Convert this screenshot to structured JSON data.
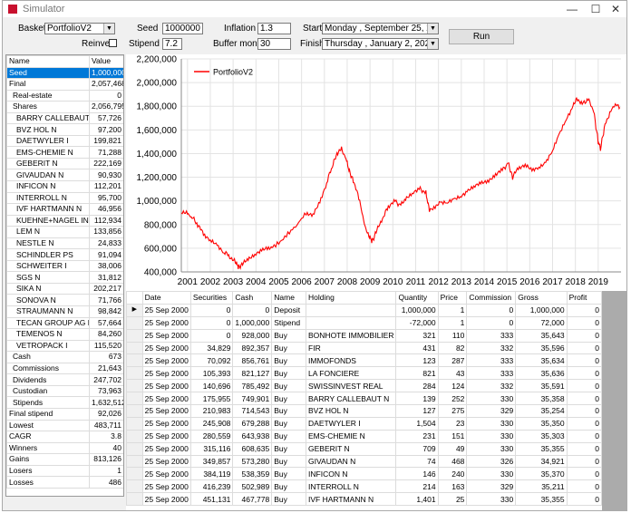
{
  "window": {
    "title": "Simulator"
  },
  "controls": {
    "basket_label": "Basket",
    "basket_value": "PortfolioV2",
    "reinvest_label": "Reinvest",
    "seed_label": "Seed",
    "seed_value": "1000000",
    "stipend_label": "Stipend %",
    "stipend_value": "7.2",
    "inflation_label": "Inflation %",
    "inflation_value": "1.3",
    "buffer_label": "Buffer months",
    "buffer_value": "30",
    "start_label": "Start",
    "start_value": "Monday   , September 25, 2000",
    "finish_label": "Finish",
    "finish_value": "Thursday   ,   January    2, 2020",
    "run_label": "Run"
  },
  "left_table": {
    "headers": [
      "Name",
      "Value"
    ],
    "rows": [
      {
        "name": "Seed",
        "value": "1,000,000"
      },
      {
        "name": "Final",
        "value": "2,057,468"
      },
      {
        "name": "Real-estate",
        "value": "0"
      },
      {
        "name": "Shares",
        "value": "2,056,795"
      },
      {
        "name": "BARRY CALLEBAUT N",
        "value": "57,726"
      },
      {
        "name": "BVZ HOL N",
        "value": "97,200"
      },
      {
        "name": "DAETWYLER I",
        "value": "199,821"
      },
      {
        "name": "EMS-CHEMIE N",
        "value": "71,288"
      },
      {
        "name": "GEBERIT N",
        "value": "222,169"
      },
      {
        "name": "GIVAUDAN N",
        "value": "90,930"
      },
      {
        "name": "INFICON N",
        "value": "112,201"
      },
      {
        "name": "INTERROLL N",
        "value": "95,700"
      },
      {
        "name": "IVF HARTMANN N",
        "value": "46,956"
      },
      {
        "name": "KUEHNE+NAGEL INT N",
        "value": "112,934"
      },
      {
        "name": "LEM N",
        "value": "133,856"
      },
      {
        "name": "NESTLE N",
        "value": "24,833"
      },
      {
        "name": "SCHINDLER PS",
        "value": "91,094"
      },
      {
        "name": "SCHWEITER I",
        "value": "38,006"
      },
      {
        "name": "SGS N",
        "value": "31,812"
      },
      {
        "name": "SIKA N",
        "value": "202,217"
      },
      {
        "name": "SONOVA N",
        "value": "71,766"
      },
      {
        "name": "STRAUMANN N",
        "value": "98,842"
      },
      {
        "name": "TECAN GROUP AG N",
        "value": "57,664"
      },
      {
        "name": "TEMENOS N",
        "value": "84,260"
      },
      {
        "name": "VETROPACK I",
        "value": "115,520"
      },
      {
        "name": "Cash",
        "value": "673"
      },
      {
        "name": "Commissions",
        "value": "21,643"
      },
      {
        "name": "Dividends",
        "value": "247,702"
      },
      {
        "name": "Custodian",
        "value": "73,963"
      },
      {
        "name": "Stipends",
        "value": "1,632,512"
      },
      {
        "name": "Final stipend",
        "value": "92,026"
      },
      {
        "name": "Lowest",
        "value": "483,711"
      },
      {
        "name": "CAGR",
        "value": "3.8"
      },
      {
        "name": "Winners",
        "value": "40"
      },
      {
        "name": "Gains",
        "value": "813,126"
      },
      {
        "name": "Losers",
        "value": "1"
      },
      {
        "name": "Losses",
        "value": "486"
      }
    ]
  },
  "chart_data": {
    "type": "line",
    "title": "",
    "xlabel": "",
    "ylabel": "",
    "x_ticks": [
      "2001",
      "2002",
      "2003",
      "2004",
      "2005",
      "2006",
      "2007",
      "2008",
      "2009",
      "2010",
      "2011",
      "2012",
      "2013",
      "2014",
      "2015",
      "2016",
      "2017",
      "2018",
      "2019"
    ],
    "y_ticks": [
      "400,000",
      "600,000",
      "800,000",
      "1,000,000",
      "1,200,000",
      "1,400,000",
      "1,600,000",
      "1,800,000",
      "2,000,000",
      "2,200,000"
    ],
    "ylim": [
      400000,
      2200000
    ],
    "xlim": [
      2000.73,
      2020.0
    ],
    "grid": true,
    "legend": "top-left",
    "series": [
      {
        "name": "PortfolioV2",
        "color": "#ff0000",
        "points": [
          [
            2000.73,
            910000
          ],
          [
            2001.0,
            890000
          ],
          [
            2001.2,
            860000
          ],
          [
            2001.45,
            800000
          ],
          [
            2001.7,
            720000
          ],
          [
            2002.0,
            660000
          ],
          [
            2002.3,
            620000
          ],
          [
            2002.6,
            570000
          ],
          [
            2002.85,
            530000
          ],
          [
            2003.1,
            480000
          ],
          [
            2003.25,
            440000
          ],
          [
            2003.45,
            470000
          ],
          [
            2003.7,
            520000
          ],
          [
            2004.0,
            560000
          ],
          [
            2004.3,
            580000
          ],
          [
            2004.6,
            600000
          ],
          [
            2005.0,
            640000
          ],
          [
            2005.4,
            720000
          ],
          [
            2005.8,
            800000
          ],
          [
            2006.2,
            900000
          ],
          [
            2006.5,
            880000
          ],
          [
            2006.8,
            980000
          ],
          [
            2007.1,
            1150000
          ],
          [
            2007.35,
            1300000
          ],
          [
            2007.55,
            1400000
          ],
          [
            2007.75,
            1440000
          ],
          [
            2007.95,
            1350000
          ],
          [
            2008.1,
            1250000
          ],
          [
            2008.3,
            1150000
          ],
          [
            2008.55,
            1000000
          ],
          [
            2008.75,
            800000
          ],
          [
            2008.95,
            700000
          ],
          [
            2009.1,
            660000
          ],
          [
            2009.3,
            750000
          ],
          [
            2009.55,
            850000
          ],
          [
            2009.8,
            950000
          ],
          [
            2010.1,
            1000000
          ],
          [
            2010.35,
            960000
          ],
          [
            2010.6,
            1030000
          ],
          [
            2010.9,
            1080000
          ],
          [
            2011.2,
            1100000
          ],
          [
            2011.45,
            1070000
          ],
          [
            2011.6,
            920000
          ],
          [
            2011.9,
            960000
          ],
          [
            2012.1,
            990000
          ],
          [
            2012.4,
            980000
          ],
          [
            2012.7,
            1010000
          ],
          [
            2013.0,
            1050000
          ],
          [
            2013.3,
            1090000
          ],
          [
            2013.6,
            1120000
          ],
          [
            2013.9,
            1150000
          ],
          [
            2014.2,
            1180000
          ],
          [
            2014.5,
            1220000
          ],
          [
            2014.8,
            1260000
          ],
          [
            2015.05,
            1320000
          ],
          [
            2015.25,
            1200000
          ],
          [
            2015.5,
            1280000
          ],
          [
            2015.8,
            1300000
          ],
          [
            2016.1,
            1250000
          ],
          [
            2016.4,
            1290000
          ],
          [
            2016.7,
            1330000
          ],
          [
            2017.0,
            1420000
          ],
          [
            2017.3,
            1560000
          ],
          [
            2017.6,
            1700000
          ],
          [
            2017.9,
            1800000
          ],
          [
            2018.05,
            1870000
          ],
          [
            2018.3,
            1820000
          ],
          [
            2018.55,
            1860000
          ],
          [
            2018.8,
            1760000
          ],
          [
            2019.0,
            1500000
          ],
          [
            2019.1,
            1440000
          ],
          [
            2019.3,
            1650000
          ],
          [
            2019.55,
            1760000
          ],
          [
            2019.75,
            1820000
          ],
          [
            2019.95,
            1790000
          ]
        ]
      }
    ]
  },
  "grid": {
    "headers": [
      "Date",
      "Securities",
      "Cash",
      "Name",
      "Holding",
      "Quantity",
      "Price",
      "Commission",
      "Gross",
      "Profit"
    ],
    "rows": [
      [
        "25 Sep 2000",
        "0",
        "0",
        "Deposit",
        "",
        "1,000,000",
        "1",
        "0",
        "1,000,000",
        "0"
      ],
      [
        "25 Sep 2000",
        "0",
        "1,000,000",
        "Stipend",
        "",
        "-72,000",
        "1",
        "0",
        "72,000",
        "0"
      ],
      [
        "25 Sep 2000",
        "0",
        "928,000",
        "Buy",
        "BONHOTE IMMOBILIER",
        "321",
        "110",
        "333",
        "35,643",
        "0"
      ],
      [
        "25 Sep 2000",
        "34,829",
        "892,357",
        "Buy",
        "FIR",
        "431",
        "82",
        "332",
        "35,596",
        "0"
      ],
      [
        "25 Sep 2000",
        "70,092",
        "856,761",
        "Buy",
        "IMMOFONDS",
        "123",
        "287",
        "333",
        "35,634",
        "0"
      ],
      [
        "25 Sep 2000",
        "105,393",
        "821,127",
        "Buy",
        "LA FONCIERE",
        "821",
        "43",
        "333",
        "35,636",
        "0"
      ],
      [
        "25 Sep 2000",
        "140,696",
        "785,492",
        "Buy",
        "SWISSINVEST REAL",
        "284",
        "124",
        "332",
        "35,591",
        "0"
      ],
      [
        "25 Sep 2000",
        "175,955",
        "749,901",
        "Buy",
        "BARRY CALLEBAUT N",
        "139",
        "252",
        "330",
        "35,358",
        "0"
      ],
      [
        "25 Sep 2000",
        "210,983",
        "714,543",
        "Buy",
        "BVZ HOL N",
        "127",
        "275",
        "329",
        "35,254",
        "0"
      ],
      [
        "25 Sep 2000",
        "245,908",
        "679,288",
        "Buy",
        "DAETWYLER I",
        "1,504",
        "23",
        "330",
        "35,350",
        "0"
      ],
      [
        "25 Sep 2000",
        "280,559",
        "643,938",
        "Buy",
        "EMS-CHEMIE N",
        "231",
        "151",
        "330",
        "35,303",
        "0"
      ],
      [
        "25 Sep 2000",
        "315,116",
        "608,635",
        "Buy",
        "GEBERIT N",
        "709",
        "49",
        "330",
        "35,355",
        "0"
      ],
      [
        "25 Sep 2000",
        "349,857",
        "573,280",
        "Buy",
        "GIVAUDAN N",
        "74",
        "468",
        "326",
        "34,921",
        "0"
      ],
      [
        "25 Sep 2000",
        "384,119",
        "538,359",
        "Buy",
        "INFICON N",
        "146",
        "240",
        "330",
        "35,370",
        "0"
      ],
      [
        "25 Sep 2000",
        "416,239",
        "502,989",
        "Buy",
        "INTERROLL N",
        "214",
        "163",
        "329",
        "35,211",
        "0"
      ],
      [
        "25 Sep 2000",
        "451,131",
        "467,778",
        "Buy",
        "IVF HARTMANN N",
        "1,401",
        "25",
        "330",
        "35,355",
        "0"
      ]
    ]
  }
}
